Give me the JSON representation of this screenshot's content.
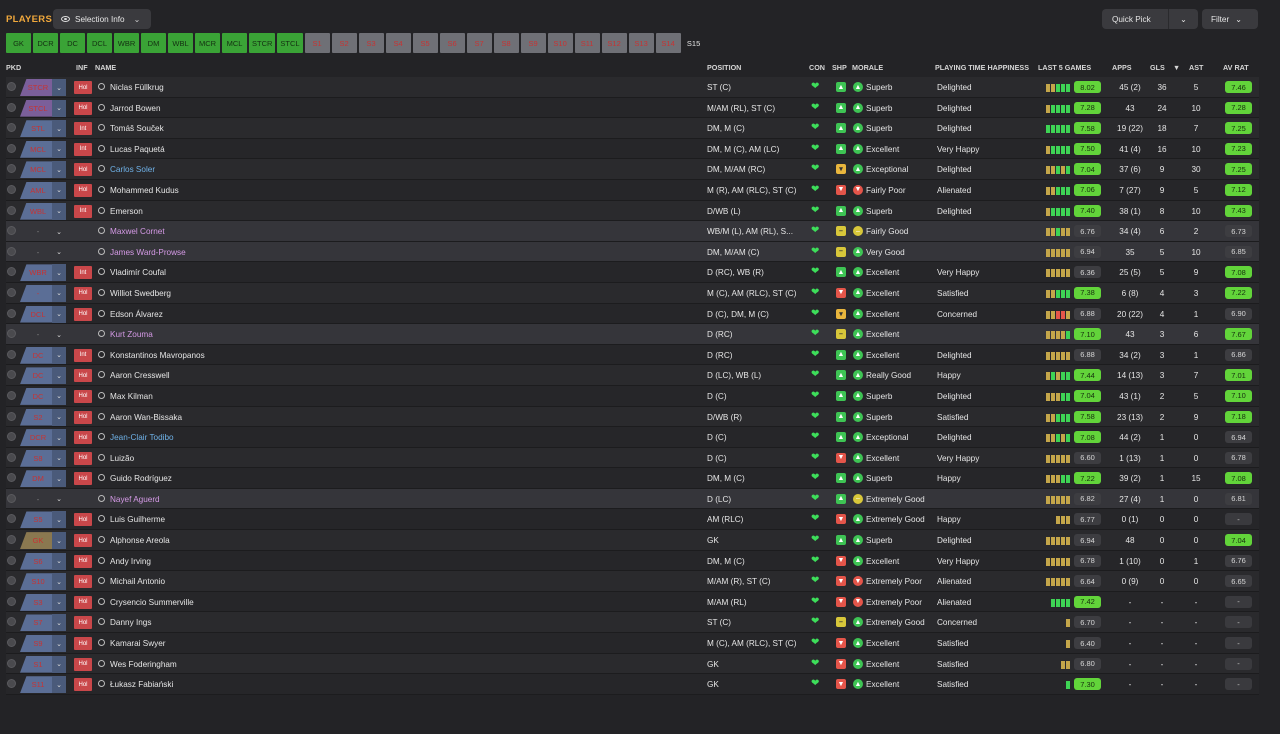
{
  "header": {
    "title": "PLAYERS",
    "selection_info": "Selection Info",
    "quick_pick": "Quick Pick",
    "filter": "Filter"
  },
  "position_tabs": [
    {
      "label": "GK",
      "state": "set"
    },
    {
      "label": "DCR",
      "state": "set"
    },
    {
      "label": "DC",
      "state": "set"
    },
    {
      "label": "DCL",
      "state": "set"
    },
    {
      "label": "WBR",
      "state": "set"
    },
    {
      "label": "DM",
      "state": "set"
    },
    {
      "label": "WBL",
      "state": "set"
    },
    {
      "label": "MCR",
      "state": "set"
    },
    {
      "label": "MCL",
      "state": "set"
    },
    {
      "label": "STCR",
      "state": "set"
    },
    {
      "label": "STCL",
      "state": "set"
    },
    {
      "label": "S1",
      "state": "sub"
    },
    {
      "label": "S2",
      "state": "sub"
    },
    {
      "label": "S3",
      "state": "sub"
    },
    {
      "label": "S4",
      "state": "sub"
    },
    {
      "label": "S5",
      "state": "sub"
    },
    {
      "label": "S6",
      "state": "sub"
    },
    {
      "label": "S7",
      "state": "sub"
    },
    {
      "label": "S8",
      "state": "sub"
    },
    {
      "label": "S9",
      "state": "sub"
    },
    {
      "label": "S10",
      "state": "sub"
    },
    {
      "label": "S11",
      "state": "sub"
    },
    {
      "label": "S12",
      "state": "sub"
    },
    {
      "label": "S13",
      "state": "sub"
    },
    {
      "label": "S14",
      "state": "sub"
    },
    {
      "label": "S15",
      "state": "empty"
    }
  ],
  "columns": {
    "pkd": "PKD",
    "inf": "INF",
    "name": "NAME",
    "position": "POSITION",
    "con": "CON",
    "shp": "SHP",
    "morale": "MORALE",
    "pth": "PLAYING TIME HAPPINESS",
    "last5": "LAST 5 GAMES",
    "apps": "APPS",
    "gls": "GLS",
    "sort": "▼",
    "ast": "AST",
    "avrat": "AV RAT"
  },
  "colors": {
    "green": "#3aa336",
    "lime": "#62d43a",
    "red": "#e4554a",
    "amber": "#d6b042"
  },
  "rows": [
    {
      "pkd": "STCR",
      "pkd_style": "v",
      "inf": "Hol",
      "name": "Niclas Füllkrug",
      "name_style": "",
      "position": "ST (C)",
      "shp": "up",
      "morale_icon": "up",
      "morale": "Superb",
      "pth": "Delighted",
      "form": [
        "m",
        "m",
        "g",
        "g",
        "g"
      ],
      "last5": "8.02",
      "apps": "45 (2)",
      "gls": "36",
      "ast": "5",
      "avrat": "7.46"
    },
    {
      "pkd": "STCL",
      "pkd_style": "v",
      "inf": "Hol",
      "name": "Jarrod Bowen",
      "name_style": "",
      "position": "M/AM (RL), ST (C)",
      "shp": "up",
      "morale_icon": "up",
      "morale": "Superb",
      "pth": "Delighted",
      "form": [
        "m",
        "g",
        "g",
        "g",
        "g"
      ],
      "last5": "7.28",
      "apps": "43",
      "gls": "24",
      "ast": "10",
      "avrat": "7.28"
    },
    {
      "pkd": "STL",
      "pkd_style": "",
      "inf": "Int",
      "name": "Tomáš Souček",
      "name_style": "",
      "position": "DM, M (C)",
      "shp": "up",
      "morale_icon": "up",
      "morale": "Superb",
      "pth": "Delighted",
      "form": [
        "g",
        "g",
        "g",
        "g",
        "g"
      ],
      "last5": "7.58",
      "apps": "19 (22)",
      "gls": "18",
      "ast": "7",
      "avrat": "7.25"
    },
    {
      "pkd": "MCL",
      "pkd_style": "",
      "inf": "Int",
      "name": "Lucas Paquetá",
      "name_style": "",
      "position": "DM, M (C), AM (LC)",
      "shp": "up",
      "morale_icon": "up",
      "morale": "Excellent",
      "pth": "Very Happy",
      "form": [
        "m",
        "g",
        "g",
        "g",
        "g"
      ],
      "last5": "7.50",
      "apps": "41 (4)",
      "gls": "16",
      "ast": "10",
      "avrat": "7.23"
    },
    {
      "pkd": "MCL",
      "pkd_style": "",
      "inf": "Hol",
      "name": "Carlos Soler",
      "name_style": "blue",
      "position": "DM, M/AM (RC)",
      "shp": "ok",
      "morale_icon": "up",
      "morale": "Exceptional",
      "pth": "Delighted",
      "form": [
        "m",
        "m",
        "g",
        "m",
        "g"
      ],
      "last5": "7.04",
      "apps": "37 (6)",
      "gls": "9",
      "ast": "30",
      "avrat": "7.25"
    },
    {
      "pkd": "AML",
      "pkd_style": "",
      "inf": "Hol",
      "name": "Mohammed Kudus",
      "name_style": "",
      "position": "M (R), AM (RLC), ST (C)",
      "shp": "dn",
      "morale_icon": "dn",
      "morale": "Fairly Poor",
      "pth": "Alienated",
      "form": [
        "m",
        "m",
        "g",
        "g",
        "g"
      ],
      "last5": "7.06",
      "apps": "7 (27)",
      "gls": "9",
      "ast": "5",
      "avrat": "7.12"
    },
    {
      "pkd": "WBL",
      "pkd_style": "",
      "inf": "Int",
      "name": "Emerson",
      "name_style": "",
      "position": "D/WB (L)",
      "shp": "up",
      "morale_icon": "up",
      "morale": "Superb",
      "pth": "Delighted",
      "form": [
        "m",
        "g",
        "g",
        "g",
        "g"
      ],
      "last5": "7.40",
      "apps": "38 (1)",
      "gls": "8",
      "ast": "10",
      "avrat": "7.43"
    },
    {
      "pkd": "-",
      "pkd_style": "grey",
      "inf": "",
      "name": "Maxwel Cornet",
      "name_style": "loan",
      "position": "WB/M (L), AM (RL), S...",
      "shp": "eq",
      "morale_icon": "eq",
      "morale": "Fairly Good",
      "pth": "",
      "form": [
        "m",
        "m",
        "g",
        "m",
        "m"
      ],
      "last5": "6.76",
      "apps": "34 (4)",
      "gls": "6",
      "ast": "2",
      "avrat": "6.73"
    },
    {
      "pkd": "-",
      "pkd_style": "grey",
      "inf": "",
      "name": "James Ward-Prowse",
      "name_style": "loan",
      "position": "DM, M/AM (C)",
      "shp": "eq",
      "morale_icon": "up",
      "morale": "Very Good",
      "pth": "",
      "form": [
        "m",
        "m",
        "m",
        "m",
        "m"
      ],
      "last5": "6.94",
      "apps": "35",
      "gls": "5",
      "ast": "10",
      "avrat": "6.85"
    },
    {
      "pkd": "WBR",
      "pkd_style": "",
      "inf": "Int",
      "name": "Vladimír Coufal",
      "name_style": "",
      "position": "D (RC), WB (R)",
      "shp": "up",
      "morale_icon": "up",
      "morale": "Excellent",
      "pth": "Very Happy",
      "form": [
        "m",
        "m",
        "m",
        "m",
        "m"
      ],
      "last5": "6.36",
      "apps": "25 (5)",
      "gls": "5",
      "ast": "9",
      "avrat": "7.08"
    },
    {
      "pkd": "-",
      "pkd_style": "",
      "inf": "Hol",
      "name": "Williot Swedberg",
      "name_style": "",
      "position": "M (C), AM (RLC), ST (C)",
      "shp": "dn",
      "morale_icon": "up",
      "morale": "Excellent",
      "pth": "Satisfied",
      "form": [
        "m",
        "m",
        "g",
        "g",
        "g"
      ],
      "last5": "7.38",
      "apps": "6 (8)",
      "gls": "4",
      "ast": "3",
      "avrat": "7.22"
    },
    {
      "pkd": "DCL",
      "pkd_style": "",
      "inf": "Hol",
      "name": "Edson Álvarez",
      "name_style": "",
      "position": "D (C), DM, M (C)",
      "shp": "ok",
      "morale_icon": "up",
      "morale": "Excellent",
      "pth": "Concerned",
      "form": [
        "m",
        "m",
        "r",
        "r",
        "m"
      ],
      "last5": "6.88",
      "apps": "20 (22)",
      "gls": "4",
      "ast": "1",
      "avrat": "6.90"
    },
    {
      "pkd": "-",
      "pkd_style": "grey",
      "inf": "",
      "name": "Kurt Zouma",
      "name_style": "loan",
      "position": "D (RC)",
      "shp": "eq",
      "morale_icon": "up",
      "morale": "Excellent",
      "pth": "",
      "form": [
        "m",
        "m",
        "m",
        "m",
        "g"
      ],
      "last5": "7.10",
      "apps": "43",
      "gls": "3",
      "ast": "6",
      "avrat": "7.67"
    },
    {
      "pkd": "DC",
      "pkd_style": "",
      "inf": "Int",
      "name": "Konstantinos Mavropanos",
      "name_style": "",
      "position": "D (RC)",
      "shp": "up",
      "morale_icon": "up",
      "morale": "Excellent",
      "pth": "Delighted",
      "form": [
        "m",
        "m",
        "m",
        "m",
        "m"
      ],
      "last5": "6.88",
      "apps": "34 (2)",
      "gls": "3",
      "ast": "1",
      "avrat": "6.86"
    },
    {
      "pkd": "DC",
      "pkd_style": "",
      "inf": "Hol",
      "name": "Aaron Cresswell",
      "name_style": "",
      "position": "D (LC), WB (L)",
      "shp": "up",
      "morale_icon": "up",
      "morale": "Really Good",
      "pth": "Happy",
      "form": [
        "m",
        "g",
        "m",
        "g",
        "g"
      ],
      "last5": "7.44",
      "apps": "14 (13)",
      "gls": "3",
      "ast": "7",
      "avrat": "7.01"
    },
    {
      "pkd": "DC",
      "pkd_style": "",
      "inf": "Hol",
      "name": "Max Kilman",
      "name_style": "",
      "position": "D (C)",
      "shp": "up",
      "morale_icon": "up",
      "morale": "Superb",
      "pth": "Delighted",
      "form": [
        "m",
        "m",
        "m",
        "g",
        "g"
      ],
      "last5": "7.04",
      "apps": "43 (1)",
      "gls": "2",
      "ast": "5",
      "avrat": "7.10"
    },
    {
      "pkd": "S2",
      "pkd_style": "",
      "inf": "Hol",
      "name": "Aaron Wan-Bissaka",
      "name_style": "",
      "position": "D/WB (R)",
      "shp": "up",
      "morale_icon": "up",
      "morale": "Superb",
      "pth": "Satisfied",
      "form": [
        "m",
        "m",
        "g",
        "g",
        "g"
      ],
      "last5": "7.58",
      "apps": "23 (13)",
      "gls": "2",
      "ast": "9",
      "avrat": "7.18"
    },
    {
      "pkd": "DCR",
      "pkd_style": "",
      "inf": "Hol",
      "name": "Jean-Clair Todibo",
      "name_style": "blue",
      "position": "D (C)",
      "shp": "up",
      "morale_icon": "up",
      "morale": "Exceptional",
      "pth": "Delighted",
      "form": [
        "m",
        "m",
        "g",
        "m",
        "g"
      ],
      "last5": "7.08",
      "apps": "44 (2)",
      "gls": "1",
      "ast": "0",
      "avrat": "6.94"
    },
    {
      "pkd": "S8",
      "pkd_style": "",
      "inf": "Hol",
      "name": "Luizão",
      "name_style": "",
      "position": "D (C)",
      "shp": "dn",
      "morale_icon": "up",
      "morale": "Excellent",
      "pth": "Very Happy",
      "form": [
        "m",
        "m",
        "m",
        "m",
        "m"
      ],
      "last5": "6.60",
      "apps": "1 (13)",
      "gls": "1",
      "ast": "0",
      "avrat": "6.78"
    },
    {
      "pkd": "DM",
      "pkd_style": "",
      "inf": "Hol",
      "name": "Guido Rodríguez",
      "name_style": "",
      "position": "DM, M (C)",
      "shp": "up",
      "morale_icon": "up",
      "morale": "Superb",
      "pth": "Happy",
      "form": [
        "m",
        "m",
        "m",
        "g",
        "g"
      ],
      "last5": "7.22",
      "apps": "39 (2)",
      "gls": "1",
      "ast": "15",
      "avrat": "7.08"
    },
    {
      "pkd": "-",
      "pkd_style": "grey",
      "inf": "",
      "name": "Nayef Aguerd",
      "name_style": "loan",
      "position": "D (LC)",
      "shp": "up",
      "morale_icon": "eq",
      "morale": "Extremely Good",
      "pth": "",
      "form": [
        "m",
        "m",
        "m",
        "m",
        "m"
      ],
      "last5": "6.82",
      "apps": "27 (4)",
      "gls": "1",
      "ast": "0",
      "avrat": "6.81"
    },
    {
      "pkd": "S5",
      "pkd_style": "",
      "inf": "Hol",
      "name": "Luis Guilherme",
      "name_style": "",
      "position": "AM (RLC)",
      "shp": "dn",
      "morale_icon": "up",
      "morale": "Extremely Good",
      "pth": "Happy",
      "form": [
        "m",
        "m",
        "m"
      ],
      "last5": "6.77",
      "apps": "0 (1)",
      "gls": "0",
      "ast": "0",
      "avrat": "-"
    },
    {
      "pkd": "GK",
      "pkd_style": "o",
      "inf": "Hol",
      "name": "Alphonse Areola",
      "name_style": "",
      "position": "GK",
      "shp": "up",
      "morale_icon": "up",
      "morale": "Superb",
      "pth": "Delighted",
      "form": [
        "m",
        "m",
        "m",
        "m",
        "m"
      ],
      "last5": "6.94",
      "apps": "48",
      "gls": "0",
      "ast": "0",
      "avrat": "7.04"
    },
    {
      "pkd": "S6",
      "pkd_style": "",
      "inf": "Hol",
      "name": "Andy Irving",
      "name_style": "",
      "position": "DM, M (C)",
      "shp": "dn",
      "morale_icon": "up",
      "morale": "Excellent",
      "pth": "Very Happy",
      "form": [
        "m",
        "m",
        "m",
        "m",
        "m"
      ],
      "last5": "6.78",
      "apps": "1 (10)",
      "gls": "0",
      "ast": "1",
      "avrat": "6.76"
    },
    {
      "pkd": "S10",
      "pkd_style": "",
      "inf": "Hol",
      "name": "Michail Antonio",
      "name_style": "",
      "position": "M/AM (R), ST (C)",
      "shp": "dn",
      "morale_icon": "dn",
      "morale": "Extremely Poor",
      "pth": "Alienated",
      "form": [
        "m",
        "m",
        "m",
        "m",
        "m"
      ],
      "last5": "6.64",
      "apps": "0 (9)",
      "gls": "0",
      "ast": "0",
      "avrat": "6.65"
    },
    {
      "pkd": "S3",
      "pkd_style": "",
      "inf": "Hol",
      "name": "Crysencio Summerville",
      "name_style": "",
      "position": "M/AM (RL)",
      "shp": "dn",
      "morale_icon": "dn",
      "morale": "Extremely Poor",
      "pth": "Alienated",
      "form": [
        "g",
        "g",
        "g",
        "g"
      ],
      "last5": "7.42",
      "apps": "-",
      "gls": "-",
      "ast": "-",
      "avrat": "-"
    },
    {
      "pkd": "S7",
      "pkd_style": "",
      "inf": "Hol",
      "name": "Danny Ings",
      "name_style": "",
      "position": "ST (C)",
      "shp": "eq",
      "morale_icon": "up",
      "morale": "Extremely Good",
      "pth": "Concerned",
      "form": [
        "m"
      ],
      "last5": "6.70",
      "apps": "-",
      "gls": "-",
      "ast": "-",
      "avrat": "-"
    },
    {
      "pkd": "S9",
      "pkd_style": "",
      "inf": "Hol",
      "name": "Kamarai Swyer",
      "name_style": "",
      "position": "M (C), AM (RLC), ST (C)",
      "shp": "dn",
      "morale_icon": "up",
      "morale": "Excellent",
      "pth": "Satisfied",
      "form": [
        "m"
      ],
      "last5": "6.40",
      "apps": "-",
      "gls": "-",
      "ast": "-",
      "avrat": "-"
    },
    {
      "pkd": "S1",
      "pkd_style": "",
      "inf": "Hol",
      "name": "Wes Foderingham",
      "name_style": "",
      "position": "GK",
      "shp": "dn",
      "morale_icon": "up",
      "morale": "Excellent",
      "pth": "Satisfied",
      "form": [
        "m",
        "m"
      ],
      "last5": "6.80",
      "apps": "-",
      "gls": "-",
      "ast": "-",
      "avrat": "-"
    },
    {
      "pkd": "S11",
      "pkd_style": "",
      "inf": "Hol",
      "name": "Łukasz Fabiański",
      "name_style": "",
      "position": "GK",
      "shp": "dn",
      "morale_icon": "up",
      "morale": "Excellent",
      "pth": "Satisfied",
      "form": [
        "g"
      ],
      "last5": "7.30",
      "apps": "-",
      "gls": "-",
      "ast": "-",
      "avrat": "-"
    }
  ]
}
